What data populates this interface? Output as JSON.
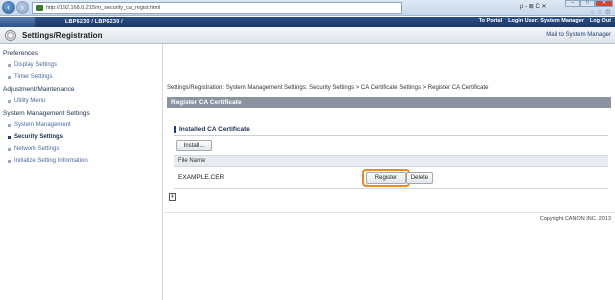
{
  "browser": {
    "url": "http://192.168.0.215/m_security_ca_regist.html",
    "tools": "ρ - ⊠ C ✕",
    "right_icons": "⌂ ☆ ⚙",
    "window": {
      "minimize": "–",
      "maximize": "□",
      "close": "✕"
    },
    "icons": {
      "back": "arrow-left-icon",
      "forward": "arrow-right-icon"
    }
  },
  "header": {
    "printer_name": "LBP6230 / LBP6230 /",
    "to_portal": "To Portal",
    "login_user": "Login User: System Manager",
    "log_out": "Log Out"
  },
  "title_bar": {
    "title": "Settings/Registration",
    "mail_link": "Mail to System Manager",
    "icon": "settings-icon"
  },
  "sidebar": {
    "sections": [
      {
        "label": "Preferences"
      },
      {
        "label": "Adjustment/Maintenance"
      },
      {
        "label": "System Management Settings"
      }
    ],
    "items": [
      {
        "label": "Display Settings"
      },
      {
        "label": "Timer Settings"
      },
      {
        "label": "Utility Menu"
      },
      {
        "label": "System Management"
      },
      {
        "label": "Security Settings"
      },
      {
        "label": "Network Settings"
      },
      {
        "label": "Initialize Setting Information"
      }
    ]
  },
  "main": {
    "breadcrumb": "Settings/Registration: System Management Settings: Security Settings > CA Certificate Settings > Register CA Certificate",
    "section_title": "Register CA Certificate",
    "subsection_title": "Installed CA Certificate",
    "install_button": "Install...",
    "table": {
      "column_header": "File Name",
      "rows": [
        {
          "file_name": "EXAMPLE.CER",
          "register_label": "Register",
          "delete_label": "Delete"
        }
      ]
    },
    "scroll_glyph": "⇞",
    "copyright": "Copyright CANON INC. 2013"
  },
  "colors": {
    "header_bg": "#1b3765",
    "section_bar": "#8a939f",
    "highlight": "#f08a1c"
  }
}
